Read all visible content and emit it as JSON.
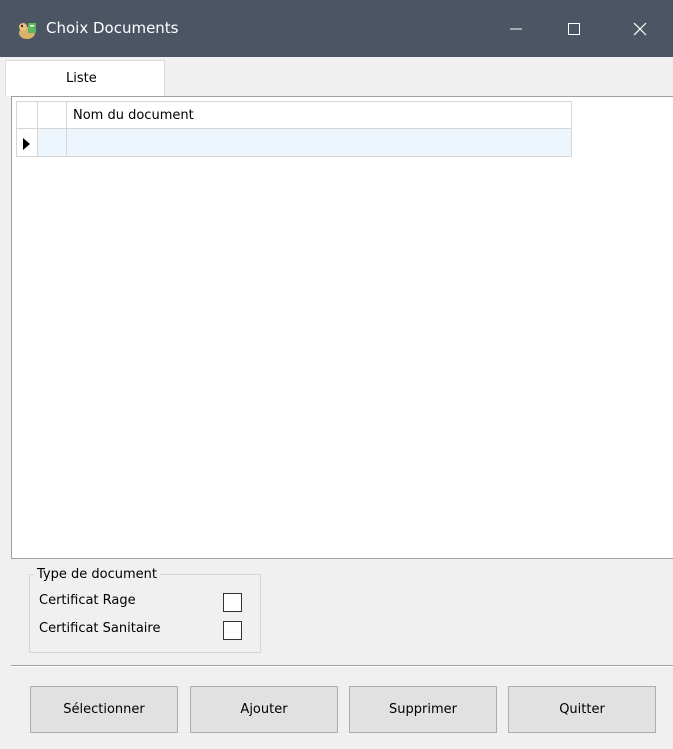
{
  "window": {
    "title": "Choix Documents",
    "controls": [
      "minimize",
      "maximize",
      "close"
    ]
  },
  "tabs": [
    {
      "label": "Liste",
      "active": true
    }
  ],
  "grid": {
    "columns": [
      "",
      "",
      "Nom du document"
    ],
    "rows": [
      {
        "current": true,
        "cells": [
          "",
          ""
        ]
      }
    ]
  },
  "document_type": {
    "legend": "Type de document",
    "options": [
      {
        "label": "Certificat Rage",
        "checked": false
      },
      {
        "label": "Certificat Sanitaire",
        "checked": false
      }
    ]
  },
  "buttons": {
    "select": "Sélectionner",
    "add": "Ajouter",
    "delete": "Supprimer",
    "quit": "Quitter"
  },
  "colors": {
    "titlebar": "#4b5563",
    "selected_row": "#eef6fd"
  }
}
